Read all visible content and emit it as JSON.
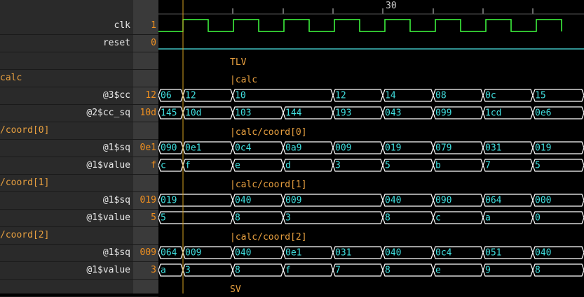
{
  "timeline": {
    "tick_label": "30"
  },
  "rows": [
    {
      "kind": "signal",
      "name": "clk",
      "value": "1",
      "wave": "clock"
    },
    {
      "kind": "signal",
      "name": "reset",
      "value": "0",
      "wave": "low"
    },
    {
      "kind": "header",
      "scope": "",
      "label": "TLV"
    },
    {
      "kind": "header",
      "scope": "calc",
      "label": "|calc"
    },
    {
      "kind": "signal",
      "name": "@3$cc",
      "value": "12",
      "segs": [
        "06",
        "12",
        "10",
        "12",
        "14",
        "08",
        "0c",
        "15"
      ]
    },
    {
      "kind": "signal",
      "name": "@2$cc_sq",
      "value": "10d",
      "segs": [
        "145",
        "10d",
        "103",
        "144",
        "193",
        "043",
        "099",
        "1cd",
        "0e6"
      ]
    },
    {
      "kind": "header",
      "scope": "/coord[0]",
      "label": "|calc/coord[0]"
    },
    {
      "kind": "signal",
      "name": "@1$sq",
      "value": "0e1",
      "segs": [
        "090",
        "0e1",
        "0c4",
        "0a9",
        "009",
        "019",
        "079",
        "031",
        "019"
      ]
    },
    {
      "kind": "signal",
      "name": "@1$value",
      "value": "f",
      "segs": [
        "c",
        "f",
        "e",
        "d",
        "3",
        "5",
        "b",
        "7",
        "5"
      ]
    },
    {
      "kind": "header",
      "scope": "/coord[1]",
      "label": "|calc/coord[1]"
    },
    {
      "kind": "signal",
      "name": "@1$sq",
      "value": "019",
      "segs": [
        "019",
        "040",
        "009",
        "040",
        "090",
        "064",
        "000"
      ]
    },
    {
      "kind": "signal",
      "name": "@1$value",
      "value": "5",
      "segs": [
        "5",
        "8",
        "3",
        "8",
        "c",
        "a",
        "0"
      ]
    },
    {
      "kind": "header",
      "scope": "/coord[2]",
      "label": "|calc/coord[2]"
    },
    {
      "kind": "signal",
      "name": "@1$sq",
      "value": "009",
      "segs": [
        "064",
        "009",
        "040",
        "0e1",
        "031",
        "040",
        "0c4",
        "051",
        "040"
      ]
    },
    {
      "kind": "signal",
      "name": "@1$value",
      "value": "3",
      "segs": [
        "a",
        "3",
        "8",
        "f",
        "7",
        "8",
        "e",
        "9",
        "8"
      ]
    },
    {
      "kind": "header",
      "scope": "",
      "label": "SV"
    }
  ],
  "colors": {
    "signal_wave": "#ffffff",
    "value_text": "#40e0e0",
    "clock": "#40ff40",
    "cursor": "#d4a020",
    "header_text": "#e8a040"
  }
}
